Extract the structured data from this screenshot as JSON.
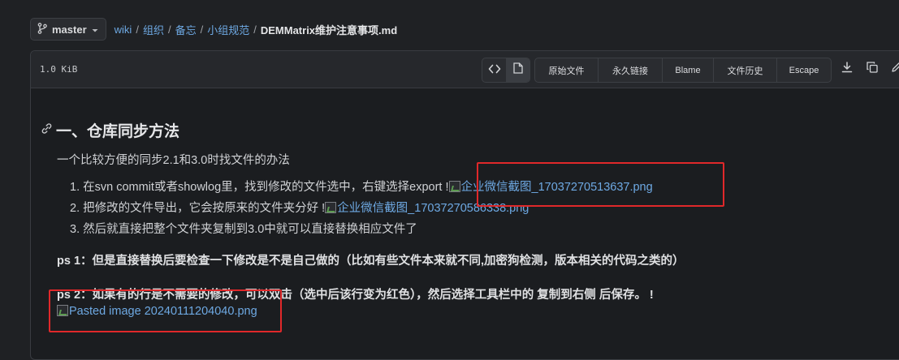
{
  "branch": {
    "name": "master"
  },
  "breadcrumb": {
    "items": [
      "wiki",
      "组织",
      "备忘",
      "小组规范"
    ],
    "separator": "/",
    "current": "DEMMatrix维护注意事项.md"
  },
  "file_header": {
    "size": "1.0 KiB",
    "buttons": [
      "原始文件",
      "永久链接",
      "Blame",
      "文件历史",
      "Escape"
    ]
  },
  "content": {
    "heading": "一、仓库同步方法",
    "intro": "一个比较方便的同步2.1和3.0时找文件的办法",
    "steps": [
      {
        "num": "1.",
        "text": "在svn commit或者showlog里，找到修改的文件选中，右键选择export !",
        "image": "企业微信截图_17037270513637.png"
      },
      {
        "num": "2.",
        "text": "把修改的文件导出，它会按原来的文件夹分好 !",
        "image": "企业微信截图_17037270586338.png"
      },
      {
        "num": "3.",
        "text": "然后就直接把整个文件夹复制到3.0中就可以直接替换相应文件了",
        "image": ""
      }
    ],
    "ps1": "ps 1：但是直接替换后要检查一下修改是不是自己做的（比如有些文件本来就不同,加密狗检测，版本相关的代码之类的）",
    "ps2": "ps 2：如果有的行是不需要的修改，可以双击（选中后该行变为红色），然后选择工具栏中的 复制到右侧 后保存。 !",
    "ps2_image": "Pasted image 20240111204040.png"
  },
  "colors": {
    "link": "#6ea9e3",
    "highlight_box": "#e0282a",
    "background": "#1f2124"
  }
}
